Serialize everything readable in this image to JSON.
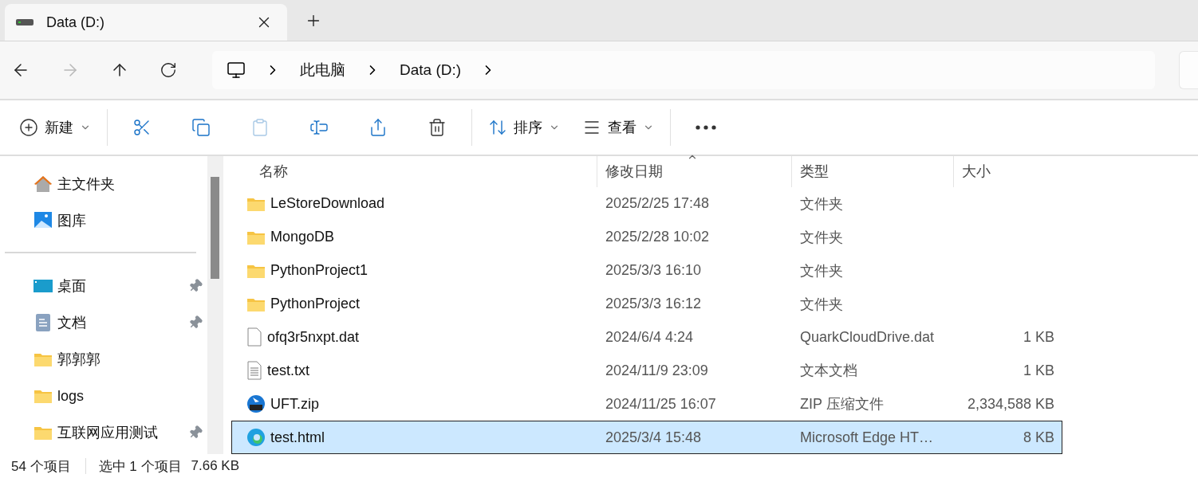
{
  "tabs": [
    {
      "title": "Data (D:)",
      "selected": true
    }
  ],
  "breadcrumb": [
    "此电脑",
    "Data (D:)"
  ],
  "nav": {
    "back_disabled": false,
    "forward_disabled": true
  },
  "toolbar": [
    {
      "label": "新建",
      "dropdown": true,
      "disabled": false
    },
    {
      "disabled": false
    },
    {
      "disabled": false
    },
    {
      "disabled": true
    },
    {
      "disabled": false
    },
    {
      "disabled": false
    },
    {
      "disabled": false
    },
    {
      "label": "排序",
      "dropdown": true,
      "disabled": false
    },
    {
      "label": "查看",
      "dropdown": true,
      "disabled": false
    },
    {
      "disabled": false
    }
  ],
  "sidebar": {
    "sections": [
      [
        {
          "label": "主文件夹",
          "kind": "home",
          "pinned": false
        },
        {
          "label": "图库",
          "kind": "gallery",
          "pinned": false
        }
      ],
      [
        {
          "label": "桌面",
          "kind": "desktop",
          "pinned": true
        },
        {
          "label": "文档",
          "kind": "documents",
          "pinned": true
        },
        {
          "label": "郭郭郭",
          "kind": "folder",
          "pinned": false
        },
        {
          "label": "logs",
          "kind": "folder",
          "pinned": false
        },
        {
          "label": "互联网应用测试",
          "kind": "folder",
          "pinned": true
        }
      ]
    ]
  },
  "table": {
    "columns": [
      {
        "label": "名称",
        "sorted": false
      },
      {
        "label": "修改日期",
        "sorted": true
      },
      {
        "label": "类型",
        "sorted": false
      },
      {
        "label": "大小",
        "sorted": false
      }
    ],
    "rows": [
      {
        "name": "LeStoreDownload",
        "kind": "folder",
        "date": "2025/2/25 17:48",
        "type": "文件夹",
        "selected": false
      },
      {
        "name": "MongoDB",
        "kind": "folder",
        "date": "2025/2/28 10:02",
        "type": "文件夹",
        "selected": false
      },
      {
        "name": "PythonProject1",
        "kind": "folder",
        "date": "2025/3/3 16:10",
        "type": "文件夹",
        "selected": false
      },
      {
        "name": "PythonProject",
        "kind": "folder",
        "date": "2025/3/3 16:12",
        "type": "文件夹",
        "selected": false
      },
      {
        "name": "ofq3r5nxpt.dat",
        "kind": "file",
        "date": "2024/6/4 4:24",
        "type": "QuarkCloudDrive.dat",
        "size": "1 KB",
        "selected": false
      },
      {
        "name": "test.txt",
        "kind": "text",
        "date": "2024/11/9 23:09",
        "type": "文本文档",
        "size": "1 KB",
        "selected": false
      },
      {
        "name": "UFT.zip",
        "kind": "zip",
        "date": "2024/11/25 16:07",
        "type": "ZIP 压缩文件",
        "size": "2,334,588 KB",
        "selected": false
      },
      {
        "name": "test.html",
        "kind": "edge",
        "date": "2025/3/4 15:48",
        "type": "Microsoft Edge HT…",
        "size": "8 KB",
        "selected": true
      }
    ]
  },
  "status_bar": [
    "54 个项目",
    "选中 1 个项目",
    "7.66 KB"
  ]
}
